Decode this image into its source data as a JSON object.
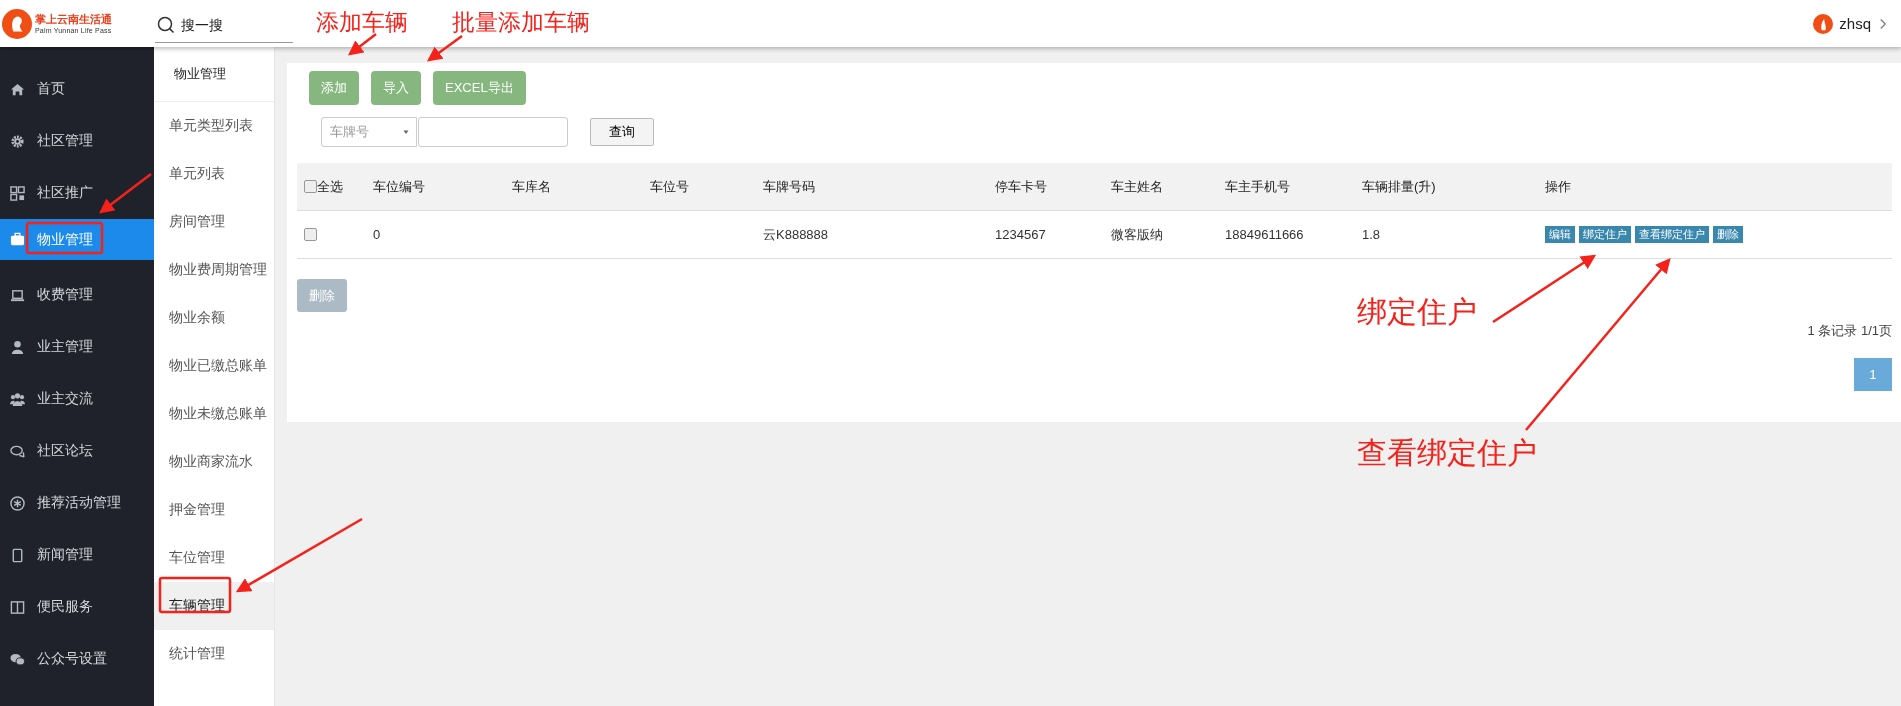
{
  "header": {
    "logo": {
      "title": "掌上云南生活通",
      "subtitle": "Palm Yunnan Life Pass"
    },
    "search": {
      "placeholder": "搜一搜"
    },
    "user": {
      "name": "zhsq"
    }
  },
  "sidebar": {
    "items": [
      {
        "label": "首页",
        "selected": false
      },
      {
        "label": "社区管理",
        "selected": false
      },
      {
        "label": "社区推广",
        "selected": false
      },
      {
        "label": "物业管理",
        "selected": true
      },
      {
        "label": "收费管理",
        "selected": false
      },
      {
        "label": "业主管理",
        "selected": false
      },
      {
        "label": "业主交流",
        "selected": false
      },
      {
        "label": "社区论坛",
        "selected": false
      },
      {
        "label": "推荐活动管理",
        "selected": false
      },
      {
        "label": "新闻管理",
        "selected": false
      },
      {
        "label": "便民服务",
        "selected": false
      },
      {
        "label": "公众号设置",
        "selected": false
      }
    ]
  },
  "submenu": {
    "title": "物业管理",
    "items": [
      {
        "label": "单元类型列表",
        "selected": false
      },
      {
        "label": "单元列表",
        "selected": false
      },
      {
        "label": "房间管理",
        "selected": false
      },
      {
        "label": "物业费周期管理",
        "selected": false
      },
      {
        "label": "物业余额",
        "selected": false
      },
      {
        "label": "物业已缴总账单",
        "selected": false
      },
      {
        "label": "物业未缴总账单",
        "selected": false
      },
      {
        "label": "物业商家流水",
        "selected": false
      },
      {
        "label": "押金管理",
        "selected": false
      },
      {
        "label": "车位管理",
        "selected": false
      },
      {
        "label": "车辆管理",
        "selected": true
      },
      {
        "label": "统计管理",
        "selected": false
      }
    ]
  },
  "toolbar": {
    "buttons": [
      "添加",
      "导入",
      "EXCEL导出"
    ]
  },
  "filter": {
    "select": "车牌号",
    "button": "查询"
  },
  "table": {
    "select_all": {
      "label": "全选",
      "checked": false
    },
    "columns": [
      "车位编号",
      "车库名",
      "车位号",
      "车牌号码",
      "停车卡号",
      "车主姓名",
      "车主手机号",
      "车辆排量(升)",
      "操作"
    ],
    "rows": [
      {
        "checked": false,
        "cells": [
          "0",
          null,
          null,
          "云K888888",
          "1234567",
          "微客版纳",
          "18849611666",
          "1.8"
        ],
        "actions": [
          "编辑",
          "绑定住户",
          "查看绑定住户",
          "删除"
        ]
      }
    ]
  },
  "bulk_delete": {
    "label": "删除",
    "disabled": true
  },
  "pagination": {
    "summary": "1 条记录 1/1页",
    "pages": [
      {
        "label": "1",
        "selected": true
      }
    ]
  },
  "annotations": [
    {
      "text": "添加车辆"
    },
    {
      "text": "批量添加车辆"
    },
    {
      "text": "绑定住户"
    },
    {
      "text": "查看绑定住户"
    }
  ]
}
